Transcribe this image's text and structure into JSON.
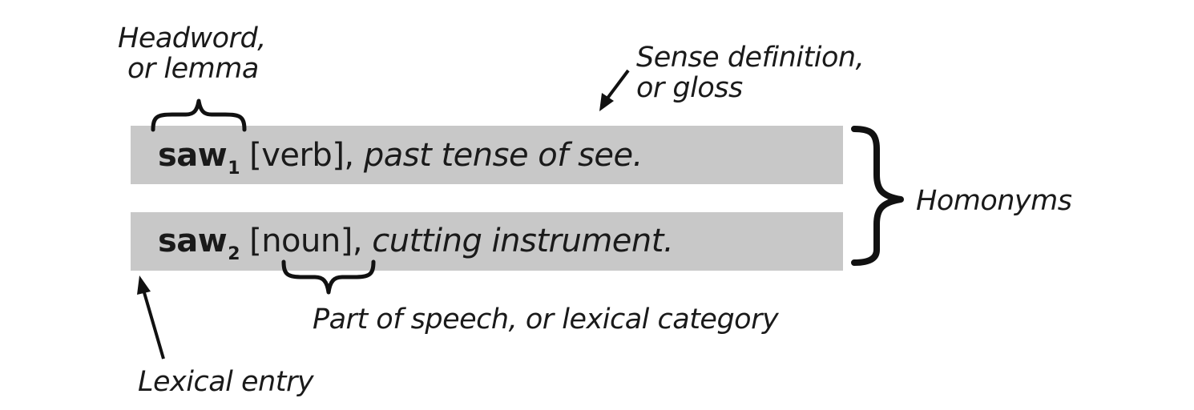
{
  "labels": {
    "headword": [
      "Headword,",
      "or lemma"
    ],
    "sense": [
      "Sense definition,",
      "or gloss"
    ],
    "homonyms": "Homonyms",
    "pos": "Part of speech, or lexical category",
    "lexical_entry": "Lexical entry"
  },
  "entries": [
    {
      "headword": "saw",
      "index": "1",
      "pos_prefix": "[",
      "pos": "verb",
      "pos_suffix": "],",
      "gloss": "past tense of see."
    },
    {
      "headword": "saw",
      "index": "2",
      "pos_prefix": "[",
      "pos": "noun",
      "pos_suffix": "],",
      "gloss": "cutting instrument."
    }
  ]
}
